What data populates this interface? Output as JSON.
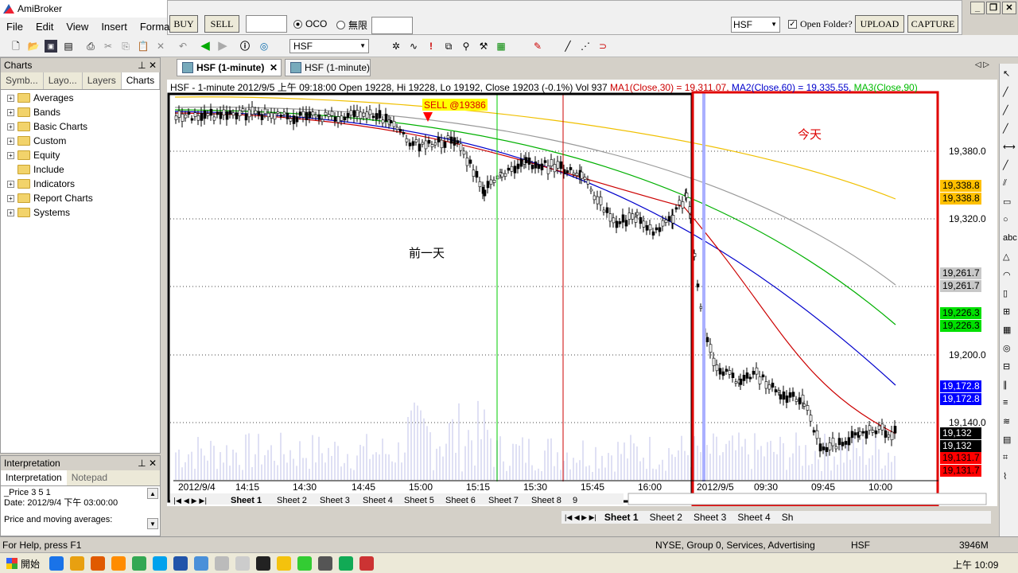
{
  "app": {
    "title": "AmiBroker"
  },
  "menu": [
    "File",
    "Edit",
    "View",
    "Insert",
    "Forma"
  ],
  "trade": {
    "buy": "BUY",
    "sell": "SELL",
    "oco": "OCO",
    "nolimit": "無限",
    "symbol": "HSF",
    "open_folder": "Open Folder?",
    "upload": "UPLOAD",
    "capture": "CAPTURE"
  },
  "toolbar": {
    "symbol": "HSF"
  },
  "panel": {
    "title": "Charts",
    "tabs": [
      "Symb...",
      "Layo...",
      "Layers",
      "Charts"
    ],
    "items": [
      "Averages",
      "Bands",
      "Basic Charts",
      "Custom",
      "Equity",
      "Include",
      "Indicators",
      "Report Charts",
      "Systems"
    ]
  },
  "interp": {
    "title": "Interpretation",
    "tabs": [
      "Interpretation",
      "Notepad"
    ],
    "line1": "_Price 3 5 1",
    "line2": "Date: 2012/9/4 下午 03:00:00",
    "line3": "Price and moving averages:"
  },
  "doctabs": [
    "HSF (1-minute)",
    "HSF (1-minute)"
  ],
  "info": {
    "main": "HSF - 1-minute 2012/9/5 上午 09:18:00 Open 19228, Hi 19228, Lo 19192, Close 19203 (-0.1%) Vol 937",
    "ma1": "MA1(Close,30) = 19,311.07,",
    "ma2": "MA2(Close,60) = 19,335.55,",
    "ma3": "MA3(Close,90)"
  },
  "annot": {
    "sell": "SELL @19386",
    "prev_day": "前一天",
    "today": "今天"
  },
  "colors": {
    "ma1": "#cc0000",
    "ma2": "#0000cc",
    "ma3": "#00b000",
    "ma4": "#999999",
    "ma5": "#f0c000",
    "box_prev": "#000000",
    "box_today": "#e00000"
  },
  "yaxis": {
    "ticks": [
      "19,380.0",
      "19,320.0",
      "19,200.0",
      "19,140.0"
    ],
    "tags": [
      {
        "t": "19,338.8",
        "bg": "#ffc000"
      },
      {
        "t": "19,338.8",
        "bg": "#ffc000"
      },
      {
        "t": "19,261.7",
        "bg": "#c8c8c8"
      },
      {
        "t": "19,261.7",
        "bg": "#c8c8c8"
      },
      {
        "t": "19,226.3",
        "bg": "#00e000"
      },
      {
        "t": "19,226.3",
        "bg": "#00e000"
      },
      {
        "t": "19,172.8",
        "bg": "#0000ff"
      },
      {
        "t": "19,172.8",
        "bg": "#0000ff"
      },
      {
        "t": "19,132",
        "bg": "#000000"
      },
      {
        "t": "19,132",
        "bg": "#000000"
      },
      {
        "t": "19,131.7",
        "bg": "#ff0000"
      },
      {
        "t": "19,131.7",
        "bg": "#ff0000"
      }
    ]
  },
  "xaxis": [
    "2012/9/4",
    "14:15",
    "14:30",
    "14:45",
    "15:00",
    "15:15",
    "15:30",
    "15:45",
    "16:00",
    "2012/9/5",
    "09:30",
    "09:45",
    "10:00"
  ],
  "sheets_inner": [
    "Sheet 1",
    "Sheet 2",
    "Sheet 3",
    "Sheet 4",
    "Sheet 5",
    "Sheet 6",
    "Sheet 7",
    "Sheet 8",
    "9"
  ],
  "sheets_outer": [
    "Sheet 1",
    "Sheet 2",
    "Sheet 3",
    "Sheet 4",
    "Sh"
  ],
  "status": {
    "help": "For Help, press F1",
    "market": "NYSE, Group 0, Services, Advertising",
    "symbol": "HSF",
    "mem": "3946M"
  },
  "taskbar": {
    "start": "開始",
    "clock": "上午 10:09"
  }
}
